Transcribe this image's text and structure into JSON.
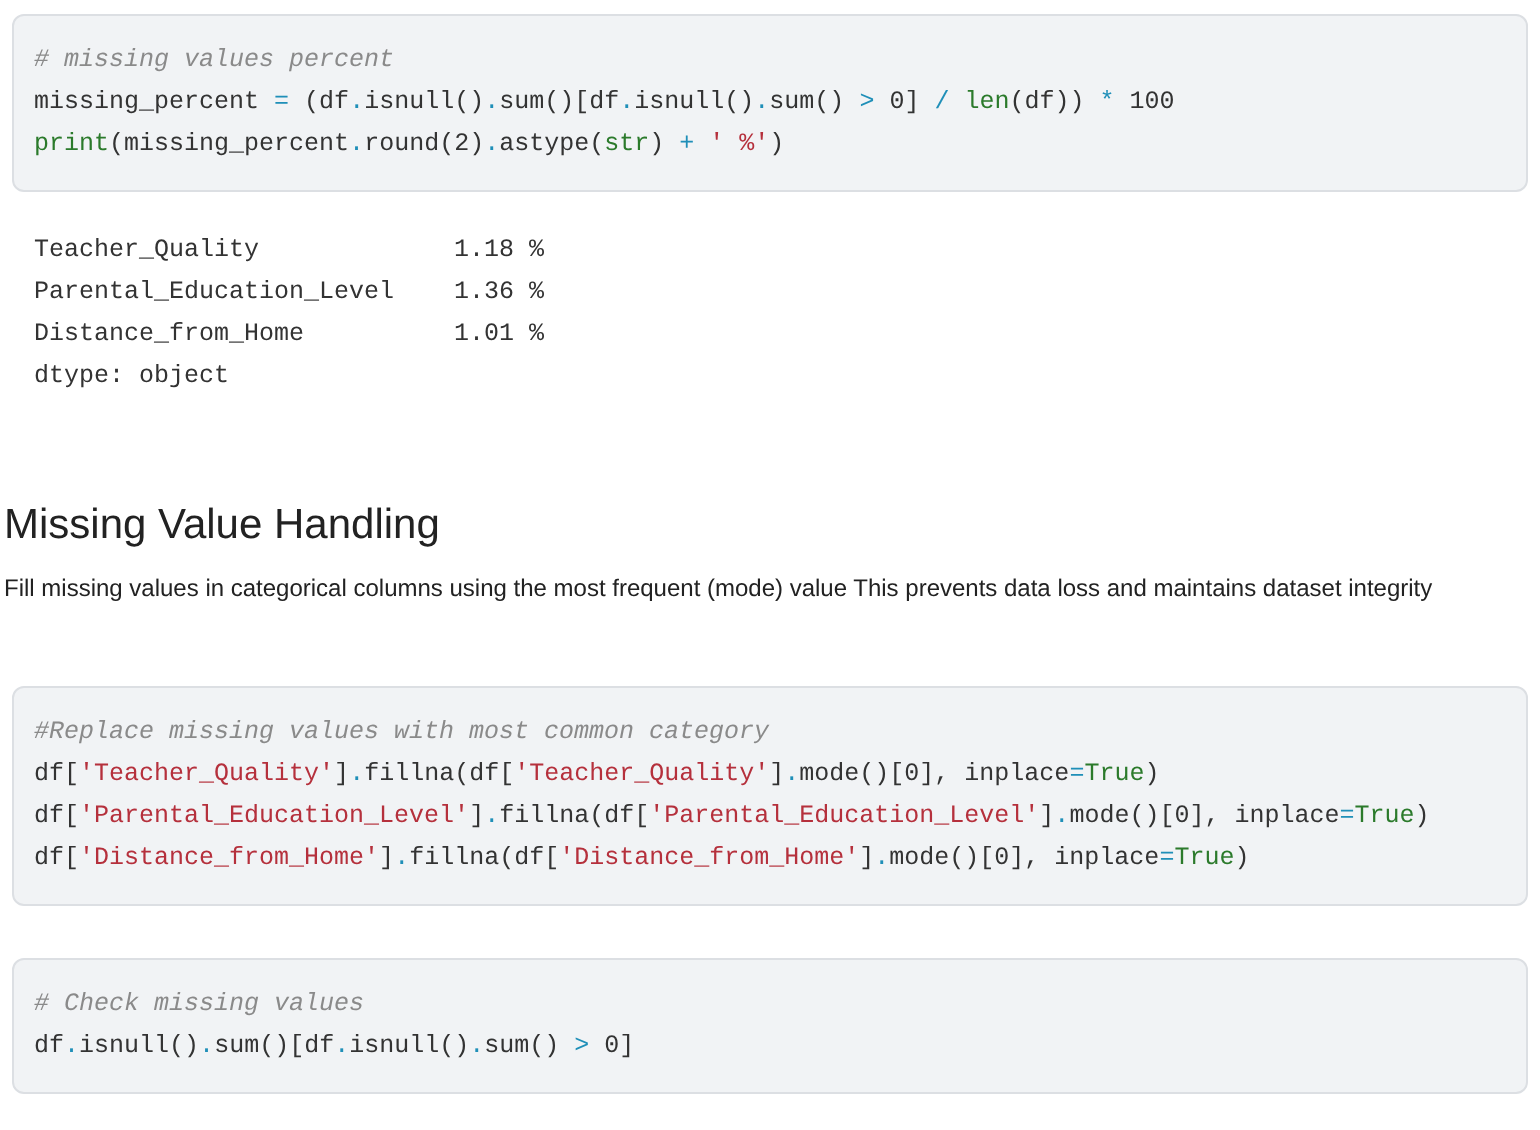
{
  "blocks": [
    {
      "kind": "code",
      "lines": [
        {
          "tokens": [
            {
              "kind": "comment",
              "text": "# missing values percent"
            }
          ]
        },
        {
          "tokens": [
            {
              "kind": "plain",
              "text": "missing_percent "
            },
            {
              "kind": "op",
              "text": "="
            },
            {
              "kind": "plain",
              "text": " (df"
            },
            {
              "kind": "op",
              "text": "."
            },
            {
              "kind": "plain",
              "text": "isnull()"
            },
            {
              "kind": "op",
              "text": "."
            },
            {
              "kind": "plain",
              "text": "sum()[df"
            },
            {
              "kind": "op",
              "text": "."
            },
            {
              "kind": "plain",
              "text": "isnull()"
            },
            {
              "kind": "op",
              "text": "."
            },
            {
              "kind": "plain",
              "text": "sum() "
            },
            {
              "kind": "op",
              "text": ">"
            },
            {
              "kind": "plain",
              "text": " 0] "
            },
            {
              "kind": "op",
              "text": "/ "
            },
            {
              "kind": "builtin",
              "text": "len"
            },
            {
              "kind": "plain",
              "text": "(df)) "
            },
            {
              "kind": "op",
              "text": "*"
            },
            {
              "kind": "plain",
              "text": " 100"
            }
          ]
        },
        {
          "tokens": [
            {
              "kind": "builtin",
              "text": "print"
            },
            {
              "kind": "plain",
              "text": "(missing_percent"
            },
            {
              "kind": "op",
              "text": "."
            },
            {
              "kind": "plain",
              "text": "round(2)"
            },
            {
              "kind": "op",
              "text": "."
            },
            {
              "kind": "plain",
              "text": "astype("
            },
            {
              "kind": "builtin",
              "text": "str"
            },
            {
              "kind": "plain",
              "text": ") "
            },
            {
              "kind": "op",
              "text": "+ "
            },
            {
              "kind": "string",
              "text": "' %'"
            },
            {
              "kind": "plain",
              "text": ")"
            }
          ]
        }
      ]
    },
    {
      "kind": "output",
      "lines": [
        "Teacher_Quality             1.18 %",
        "Parental_Education_Level    1.36 %",
        "Distance_from_Home          1.01 %",
        "dtype: object"
      ]
    },
    {
      "kind": "heading",
      "text": "Missing Value Handling"
    },
    {
      "kind": "paragraph",
      "text": "Fill missing values in categorical columns using the most frequent (mode) value This prevents data loss and maintains dataset integrity"
    },
    {
      "kind": "code",
      "lines": [
        {
          "tokens": [
            {
              "kind": "comment",
              "text": "#Replace missing values with most common category"
            }
          ]
        },
        {
          "tokens": [
            {
              "kind": "plain",
              "text": "df["
            },
            {
              "kind": "string",
              "text": "'Teacher_Quality'"
            },
            {
              "kind": "plain",
              "text": "]"
            },
            {
              "kind": "op",
              "text": "."
            },
            {
              "kind": "plain",
              "text": "fillna(df["
            },
            {
              "kind": "string",
              "text": "'Teacher_Quality'"
            },
            {
              "kind": "plain",
              "text": "]"
            },
            {
              "kind": "op",
              "text": "."
            },
            {
              "kind": "plain",
              "text": "mode()[0], inplace"
            },
            {
              "kind": "op",
              "text": "="
            },
            {
              "kind": "builtin",
              "text": "True"
            },
            {
              "kind": "plain",
              "text": ")"
            }
          ]
        },
        {
          "tokens": [
            {
              "kind": "plain",
              "text": "df["
            },
            {
              "kind": "string",
              "text": "'Parental_Education_Level'"
            },
            {
              "kind": "plain",
              "text": "]"
            },
            {
              "kind": "op",
              "text": "."
            },
            {
              "kind": "plain",
              "text": "fillna(df["
            },
            {
              "kind": "string",
              "text": "'Parental_Education_Level'"
            },
            {
              "kind": "plain",
              "text": "]"
            },
            {
              "kind": "op",
              "text": "."
            },
            {
              "kind": "plain",
              "text": "mode()[0], inplace"
            },
            {
              "kind": "op",
              "text": "="
            },
            {
              "kind": "builtin",
              "text": "True"
            },
            {
              "kind": "plain",
              "text": ")"
            }
          ]
        },
        {
          "tokens": [
            {
              "kind": "plain",
              "text": "df["
            },
            {
              "kind": "string",
              "text": "'Distance_from_Home'"
            },
            {
              "kind": "plain",
              "text": "]"
            },
            {
              "kind": "op",
              "text": "."
            },
            {
              "kind": "plain",
              "text": "fillna(df["
            },
            {
              "kind": "string",
              "text": "'Distance_from_Home'"
            },
            {
              "kind": "plain",
              "text": "]"
            },
            {
              "kind": "op",
              "text": "."
            },
            {
              "kind": "plain",
              "text": "mode()[0], inplace"
            },
            {
              "kind": "op",
              "text": "="
            },
            {
              "kind": "builtin",
              "text": "True"
            },
            {
              "kind": "plain",
              "text": ")"
            }
          ]
        }
      ]
    },
    {
      "kind": "code",
      "lines": [
        {
          "tokens": [
            {
              "kind": "comment",
              "text": "# Check missing values"
            }
          ]
        },
        {
          "tokens": [
            {
              "kind": "plain",
              "text": "df"
            },
            {
              "kind": "op",
              "text": "."
            },
            {
              "kind": "plain",
              "text": "isnull()"
            },
            {
              "kind": "op",
              "text": "."
            },
            {
              "kind": "plain",
              "text": "sum()[df"
            },
            {
              "kind": "op",
              "text": "."
            },
            {
              "kind": "plain",
              "text": "isnull()"
            },
            {
              "kind": "op",
              "text": "."
            },
            {
              "kind": "plain",
              "text": "sum() "
            },
            {
              "kind": "op",
              "text": ">"
            },
            {
              "kind": "plain",
              "text": " 0]"
            }
          ]
        }
      ]
    }
  ]
}
